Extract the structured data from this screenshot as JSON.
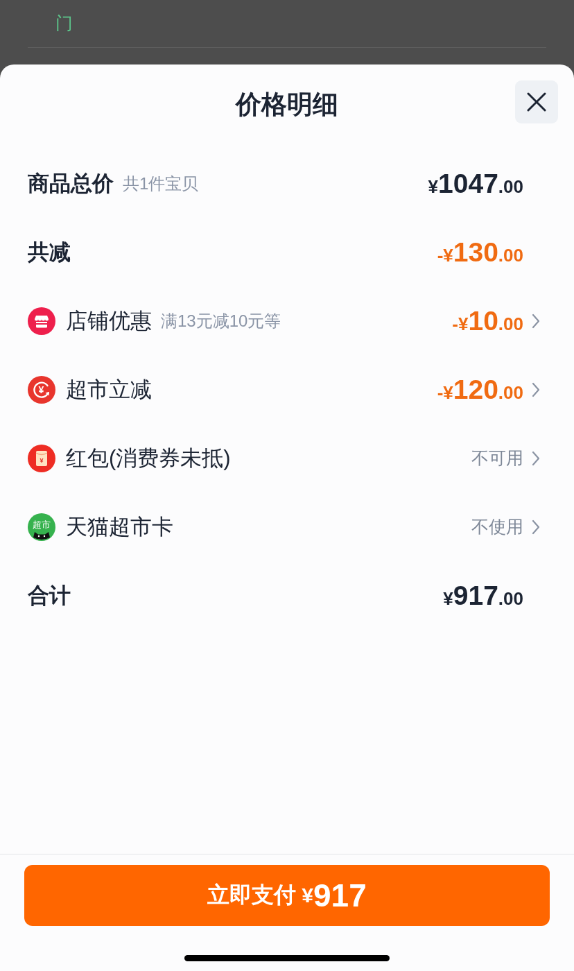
{
  "background": {
    "link": "门"
  },
  "sheet": {
    "title": "价格明细"
  },
  "rows": [
    {
      "kind": "summary",
      "label": "商品总价",
      "note": "共1件宝贝",
      "amount": {
        "prefix": "¥",
        "integer": "1047",
        "fraction": ".00"
      },
      "highlight": false
    },
    {
      "kind": "summary",
      "label": "共减",
      "amount": {
        "prefix": "-¥",
        "integer": "130",
        "fraction": ".00"
      },
      "highlight": true
    },
    {
      "kind": "store",
      "label": "店铺优惠",
      "note": "满13元减10元等",
      "amount": {
        "prefix": "-¥",
        "integer": "10",
        "fraction": ".00"
      },
      "highlight": true
    },
    {
      "kind": "instant",
      "icon_text": "¥",
      "label": "超市立减",
      "amount": {
        "prefix": "-¥",
        "integer": "120",
        "fraction": ".00"
      },
      "highlight": true
    },
    {
      "kind": "redpacket",
      "icon_text": "¥",
      "label": "红包(消费券未抵)",
      "status": "不可用"
    },
    {
      "kind": "card",
      "icon_text": "超市",
      "label": "天猫超市卡",
      "status": "不使用"
    },
    {
      "kind": "summary",
      "label": "合计",
      "amount": {
        "prefix": "¥",
        "integer": "917",
        "fraction": ".00"
      },
      "highlight": false
    }
  ],
  "footer": {
    "pay_button": {
      "label": "立即支付",
      "currency": "¥",
      "amount": "917"
    }
  }
}
